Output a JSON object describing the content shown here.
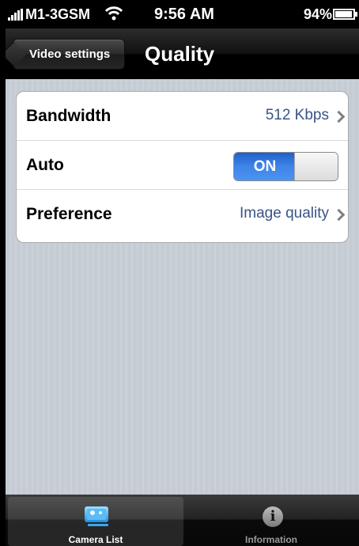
{
  "status_bar": {
    "carrier": "M1-3GSM",
    "time": "9:56 AM",
    "battery": "94%",
    "battery_level": 0.94,
    "signal_icon": "signal-bars-icon",
    "wifi_icon": "wifi-icon"
  },
  "nav": {
    "back_label": "Video settings",
    "title": "Quality"
  },
  "settings": {
    "rows": [
      {
        "label": "Bandwidth",
        "value": "512 Kbps"
      },
      {
        "label": "Auto",
        "toggle": "ON"
      },
      {
        "label": "Preference",
        "value": "Image quality"
      }
    ]
  },
  "tab_bar": {
    "items": [
      {
        "label": "Camera List",
        "icon": "camera-list-icon",
        "selected": true
      },
      {
        "label": "Information",
        "icon": "info-icon",
        "selected": false
      }
    ]
  },
  "colors": {
    "toggle_on": "#3f85ea",
    "value_text": "#385487",
    "background": "#c5ccd4"
  }
}
